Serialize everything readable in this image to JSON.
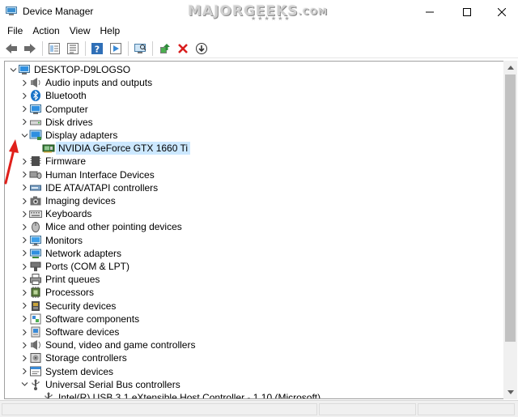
{
  "window": {
    "title": "Device Manager",
    "watermark": "MAJORGEEKS",
    "watermark_sub": ".COM",
    "watermark_stars": "★★★★★★"
  },
  "menu": [
    "File",
    "Action",
    "View",
    "Help"
  ],
  "toolbar": {
    "icons": [
      "back-icon",
      "forward-icon",
      "properties-view-icon",
      "tree-view-icon",
      "help-icon",
      "run-icon",
      "scan-hardware-icon",
      "update-driver-icon",
      "uninstall-icon",
      "download-icon"
    ]
  },
  "tree": {
    "root": "DESKTOP-D9LOGSO",
    "items": [
      {
        "label": "Audio inputs and outputs",
        "icon": "speaker-icon",
        "expanded": false
      },
      {
        "label": "Bluetooth",
        "icon": "bluetooth-icon",
        "expanded": false
      },
      {
        "label": "Computer",
        "icon": "computer-icon",
        "expanded": false
      },
      {
        "label": "Disk drives",
        "icon": "disk-icon",
        "expanded": false
      },
      {
        "label": "Display adapters",
        "icon": "display-adapter-icon",
        "expanded": true
      },
      {
        "label": "Firmware",
        "icon": "firmware-icon",
        "expanded": false
      },
      {
        "label": "Human Interface Devices",
        "icon": "hid-icon",
        "expanded": false
      },
      {
        "label": "IDE ATA/ATAPI controllers",
        "icon": "ide-icon",
        "expanded": false
      },
      {
        "label": "Imaging devices",
        "icon": "camera-icon",
        "expanded": false
      },
      {
        "label": "Keyboards",
        "icon": "keyboard-icon",
        "expanded": false
      },
      {
        "label": "Mice and other pointing devices",
        "icon": "mouse-icon",
        "expanded": false
      },
      {
        "label": "Monitors",
        "icon": "monitor-icon",
        "expanded": false
      },
      {
        "label": "Network adapters",
        "icon": "network-icon",
        "expanded": false
      },
      {
        "label": "Ports (COM & LPT)",
        "icon": "port-icon",
        "expanded": false
      },
      {
        "label": "Print queues",
        "icon": "printer-icon",
        "expanded": false
      },
      {
        "label": "Processors",
        "icon": "processor-icon",
        "expanded": false
      },
      {
        "label": "Security devices",
        "icon": "security-icon",
        "expanded": false
      },
      {
        "label": "Software components",
        "icon": "software-component-icon",
        "expanded": false
      },
      {
        "label": "Software devices",
        "icon": "software-device-icon",
        "expanded": false
      },
      {
        "label": "Sound, video and game controllers",
        "icon": "sound-icon",
        "expanded": false
      },
      {
        "label": "Storage controllers",
        "icon": "storage-icon",
        "expanded": false
      },
      {
        "label": "System devices",
        "icon": "system-icon",
        "expanded": false
      },
      {
        "label": "Universal Serial Bus controllers",
        "icon": "usb-icon",
        "expanded": true
      }
    ],
    "display_child": "NVIDIA GeForce GTX 1660 Ti",
    "usb_child": "Intel(R) USB 3.1 eXtensible Host Controller - 1.10 (Microsoft)"
  },
  "colors": {
    "selection": "#cce8ff",
    "arrow": "#e0201b",
    "accent_blue": "#1a73c8"
  }
}
